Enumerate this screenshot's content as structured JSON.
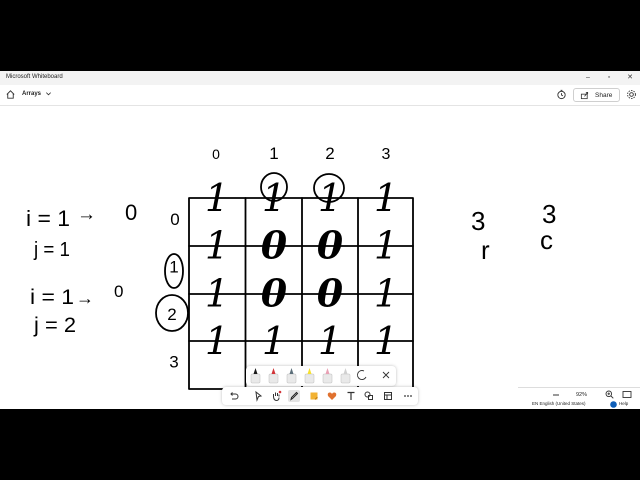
{
  "window": {
    "app_title": "Microsoft Whiteboard",
    "controls": [
      "minimize",
      "restore",
      "close"
    ]
  },
  "toolbar": {
    "board_name": "Arrays",
    "share_label": "Share",
    "icons": [
      "home-icon",
      "chevron-down-icon",
      "timer-icon",
      "share-icon",
      "gear-icon"
    ]
  },
  "board": {
    "column_labels": [
      "0",
      "1",
      "2",
      "3"
    ],
    "row_labels": [
      "0",
      "1",
      "2",
      "3"
    ],
    "matrix": [
      [
        "1",
        "1",
        "1",
        "1"
      ],
      [
        "1",
        "0",
        "0",
        "1"
      ],
      [
        "1",
        "0",
        "0",
        "1"
      ],
      [
        "1",
        "1",
        "1",
        "1"
      ]
    ],
    "note1": {
      "i": "i = 1",
      "arrow": "→",
      "result": "0",
      "j": "j = 1"
    },
    "note2": {
      "i": "i = 1",
      "arrow": "→",
      "result": "0",
      "j": "j = 2"
    },
    "rows_count": {
      "value": "3",
      "letter": "r"
    },
    "cols_count": {
      "value": "3",
      "letter": "c"
    },
    "ink_color": "#000000"
  },
  "pen_tray": {
    "items": [
      "black-pen",
      "red-pen",
      "gray-pen",
      "yellow-highlighter",
      "pink-pen",
      "eraser",
      "lasso-icon",
      "close-icon"
    ],
    "colors": [
      "#1a1a1a",
      "#d13438",
      "#5c6f7a",
      "#f5e030",
      "#e8a0b4",
      "#d0d0d0"
    ]
  },
  "tools": [
    "undo-icon",
    "select-icon",
    "hand-icon",
    "pen-icon",
    "sticky-note-icon",
    "reaction-icon",
    "text-icon",
    "shapes-icon",
    "template-icon",
    "more-icon"
  ],
  "status": {
    "zoom": "92%",
    "language": "EN English (United States)",
    "help": "Help"
  }
}
